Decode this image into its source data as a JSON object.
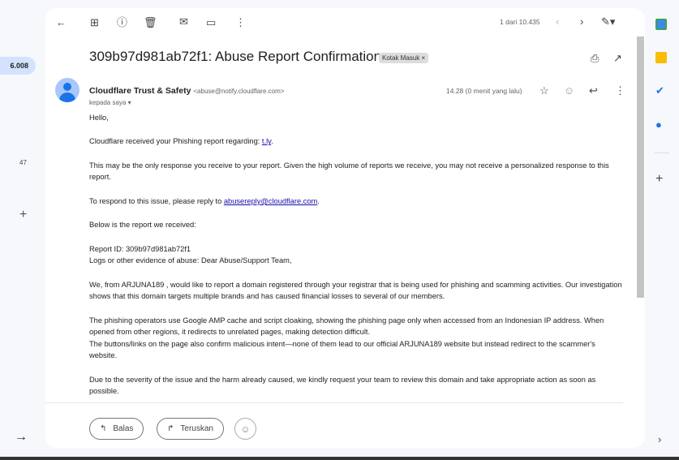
{
  "left_rail": {
    "inbox_count": "6.008",
    "other_count": "47"
  },
  "toolbar": {
    "pagination": "1 dari 10.435"
  },
  "email": {
    "subject": "309b97d981ab72f1: Abuse Report Confirmation",
    "label": "Kotak Masuk",
    "sender_name": "Cloudflare Trust & Safety",
    "sender_email": "<abuse@notify.cloudflare.com>",
    "to": "kepada saya",
    "time": "14.28 (0 menit yang lalu)",
    "body": {
      "p1": "Hello,",
      "p2_text": "Cloudflare received your Phishing report regarding: ",
      "p2_link": "t.ly",
      "p2_end": ".",
      "p3": "This may be the only response you receive to your report. Given the high volume of reports we receive, you may not receive a personalized response to this report.",
      "p4_text": "To respond to this issue, please reply to ",
      "p4_link": "abusereply@cloudflare.com",
      "p4_end": ".",
      "p5": "Below is the report we received:",
      "p6_l1": "Report ID: 309b97d981ab72f1",
      "p6_l2": "Logs or other evidence of abuse:  Dear Abuse/Support Team,",
      "p7": "We, from ARJUNA189 , would like to report a domain registered through your registrar that is being used for phishing and scamming activities. Our investigation shows that this domain targets multiple brands and has caused financial losses to several of our members.",
      "p8_l1": "The phishing operators use Google AMP cache and script cloaking, showing the phishing page only when accessed from an Indonesian IP address. When opened from other regions, it redirects to unrelated pages, making detection difficult.",
      "p8_l2": "The buttons/links on the page also confirm malicious intent—none of them lead to our official ARJUNA189 website but instead redirect to the scammer's website.",
      "p9": "Due to the severity of the issue and the harm already caused, we kindly request your team to review this domain and take appropriate action as soon as possible."
    }
  },
  "actions": {
    "reply": "Balas",
    "forward": "Teruskan"
  }
}
